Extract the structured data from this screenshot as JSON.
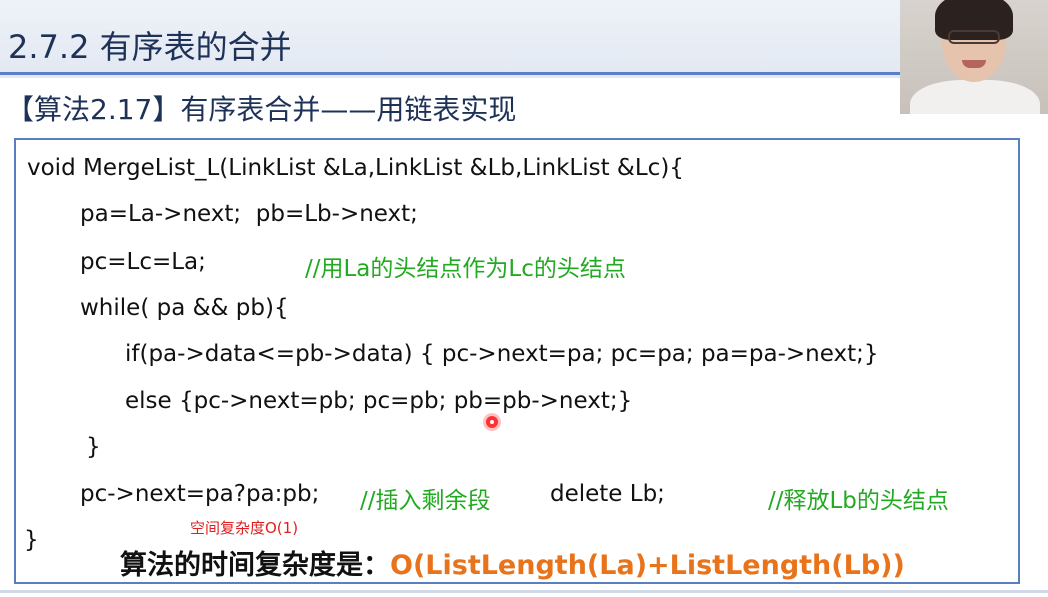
{
  "slide": {
    "section_title": "2.7.2    有序表的合并",
    "algorithm_title": "【算法2.17】有序表合并——用链表实现"
  },
  "code": {
    "line1": "void MergeList_L(LinkList &La,LinkList &Lb,LinkList &Lc){",
    "line2": "pa=La->next;  pb=Lb->next;",
    "line3_code": "pc=Lc=La;",
    "line3_comment": "//用La的头结点作为Lc的头结点",
    "line4": "while( pa && pb){",
    "line5": "if(pa->data<=pb->data) { pc->next=pa; pc=pa; pa=pa->next;}",
    "line6": "else {pc->next=pb; pc=pb; pb=pb->next;}",
    "line7": "}",
    "line8_code": "pc->next=pa?pa:pb;",
    "line8_comment1": "//插入剩余段",
    "line8_delete": "delete Lb;",
    "line8_comment2": "//释放Lb的头结点",
    "line9": "}"
  },
  "annotations": {
    "space_complexity": "空间复杂度O(1)",
    "time_complexity_label": "算法的时间复杂度是：",
    "time_complexity_value": "O(ListLength(La)+ListLength(Lb))"
  },
  "colors": {
    "comment": "#22aa22",
    "accent_orange": "#e8731a",
    "note_red": "#e02020",
    "border_blue": "#5a7fc0"
  }
}
